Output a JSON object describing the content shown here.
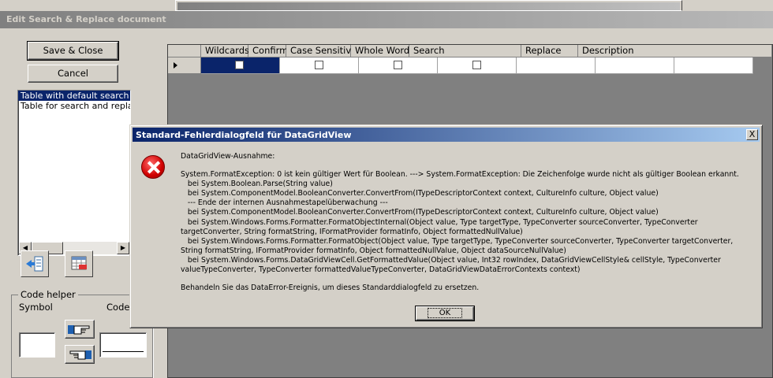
{
  "main_window": {
    "title": "Edit Search & Replace document"
  },
  "buttons": {
    "save_close": "Save & Close",
    "cancel": "Cancel"
  },
  "tables_list": {
    "items": [
      "Table with default search and",
      "Table for search and replace"
    ],
    "selected_index": 0
  },
  "code_helper": {
    "legend": "Code helper",
    "symbol_label": "Symbol",
    "code_label": "Code"
  },
  "grid": {
    "columns": [
      "Wildcards",
      "Confirm",
      "Case Sensitive",
      "Whole Word",
      "Search",
      "Replace",
      "Description"
    ]
  },
  "dialog": {
    "title": "Standard-Fehlerdialogfeld für DataGridView",
    "close_glyph": "X",
    "heading": "DataGridView-Ausnahme:",
    "body": "System.FormatException: 0 ist kein gültiger Wert für Boolean. ---> System.FormatException: Die Zeichenfolge wurde nicht als gültiger Boolean erkannt.\n   bei System.Boolean.Parse(String value)\n   bei System.ComponentModel.BooleanConverter.ConvertFrom(ITypeDescriptorContext context, CultureInfo culture, Object value)\n   --- Ende der internen Ausnahmestapelüberwachung ---\n   bei System.ComponentModel.BooleanConverter.ConvertFrom(ITypeDescriptorContext context, CultureInfo culture, Object value)\n   bei System.Windows.Forms.Formatter.FormatObjectInternal(Object value, Type targetType, TypeConverter sourceConverter, TypeConverter targetConverter, String formatString, IFormatProvider formatInfo, Object formattedNullValue)\n   bei System.Windows.Forms.Formatter.FormatObject(Object value, Type targetType, TypeConverter sourceConverter, TypeConverter targetConverter, String formatString, IFormatProvider formatInfo, Object formattedNullValue, Object dataSourceNullValue)\n   bei System.Windows.Forms.DataGridViewCell.GetFormattedValue(Object value, Int32 rowIndex, DataGridViewCellStyle& cellStyle, TypeConverter valueTypeConverter, TypeConverter formattedValueTypeConverter, DataGridViewDataErrorContexts context)",
    "footer": "Behandeln Sie das DataError-Ereignis, um dieses Standarddialogfeld zu ersetzen.",
    "ok": "OK"
  }
}
